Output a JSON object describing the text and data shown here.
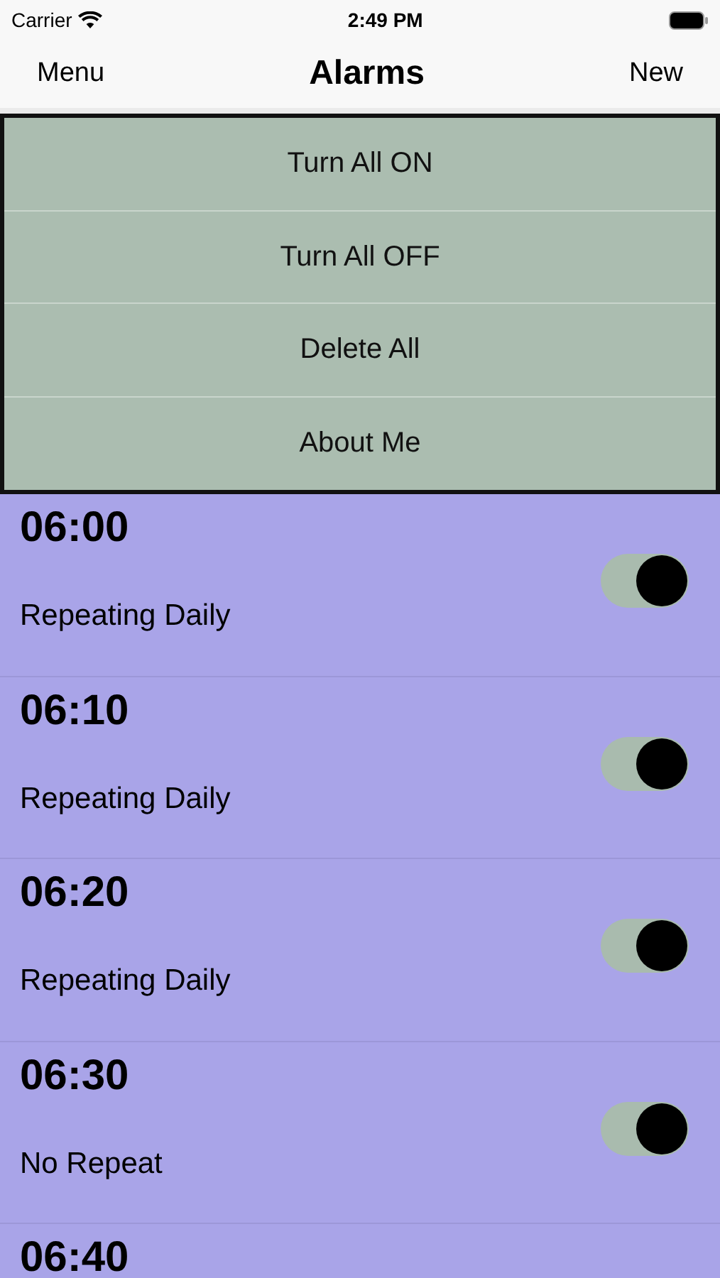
{
  "status_bar": {
    "carrier": "Carrier",
    "time": "2:49 PM"
  },
  "nav": {
    "left": "Menu",
    "title": "Alarms",
    "right": "New"
  },
  "menu": [
    {
      "label": "Turn All ON"
    },
    {
      "label": "Turn All OFF"
    },
    {
      "label": "Delete All"
    },
    {
      "label": "About Me"
    }
  ],
  "alarms": [
    {
      "time": "06:00",
      "repeat": "Repeating Daily",
      "on": true
    },
    {
      "time": "06:10",
      "repeat": "Repeating Daily",
      "on": true
    },
    {
      "time": "06:20",
      "repeat": "Repeating Daily",
      "on": true
    },
    {
      "time": "06:30",
      "repeat": "No Repeat",
      "on": true
    },
    {
      "time": "06:40"
    }
  ]
}
